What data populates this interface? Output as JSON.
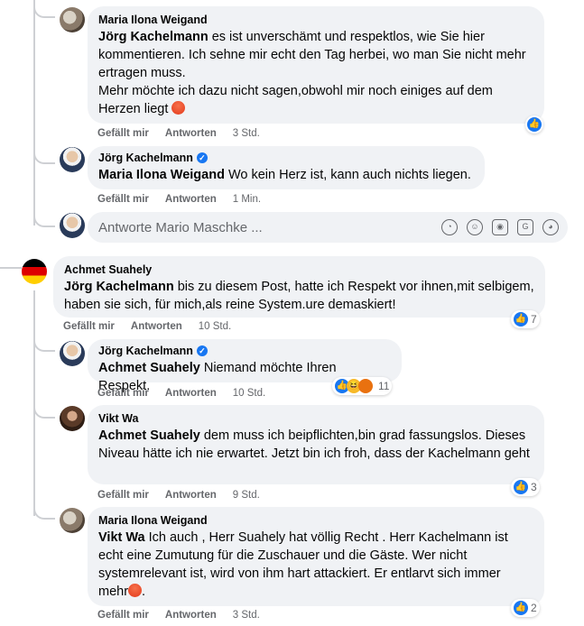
{
  "comments": [
    {
      "author": "Maria Ilona Weigand",
      "tag": "Jörg Kachelmann",
      "text": " es ist unverschämt und respektlos, wie Sie hier kommentieren. Ich sehne mir echt den Tag herbei, wo man Sie nicht mehr ertragen muss.",
      "text2": "Mehr möchte ich dazu nicht sagen,obwohl mir noch einiges auf dem Herzen liegt",
      "like": "Gefällt mir",
      "reply": "Antworten",
      "time": "3 Std."
    },
    {
      "author": "Jörg Kachelmann",
      "tag": "Maria Ilona Weigand",
      "text": " Wo kein Herz ist, kann auch nichts liegen.",
      "like": "Gefällt mir",
      "reply": "Antworten",
      "time": "1 Min."
    },
    {
      "author": "Achmet Suahely",
      "tag": "Jörg Kachelmann",
      "text": " bis zu diesem Post, hatte ich Respekt vor ihnen,mit selbigem, haben sie sich, für mich,als reine System.ure demaskiert!",
      "like": "Gefällt mir",
      "reply": "Antworten",
      "time": "10 Std.",
      "reactions": "7"
    },
    {
      "author": "Jörg Kachelmann",
      "tag": "Achmet Suahely",
      "text": " Niemand möchte Ihren Respekt.",
      "like": "Gefällt mir",
      "reply": "Antworten",
      "time": "10 Std.",
      "reactions": "11"
    },
    {
      "author": "Vikt Wa",
      "tag": "Achmet Suahely",
      "text": " dem muss ich beipflichten,bin grad fassungslos. Dieses Niveau hätte ich nie erwartet. Jetzt bin ich froh, dass der Kachelmann geht",
      "like": "Gefällt mir",
      "reply": "Antworten",
      "time": "9 Std.",
      "reactions": "3"
    },
    {
      "author": "Maria Ilona Weigand",
      "tag": "Vikt Wa",
      "text": " Ich auch , Herr Suahely hat völlig Recht . Herr Kachelmann ist echt eine Zumutung für die Zuschauer und die Gäste. Wer nicht systemrelevant ist, wird von ihm hart attackiert. Er entlarvt sich immer mehr",
      "like": "Gefällt mir",
      "reply": "Antworten",
      "time": "3 Std.",
      "reactions": "2"
    }
  ],
  "reply_box": {
    "placeholder": "Antworte Mario Maschke ..."
  }
}
